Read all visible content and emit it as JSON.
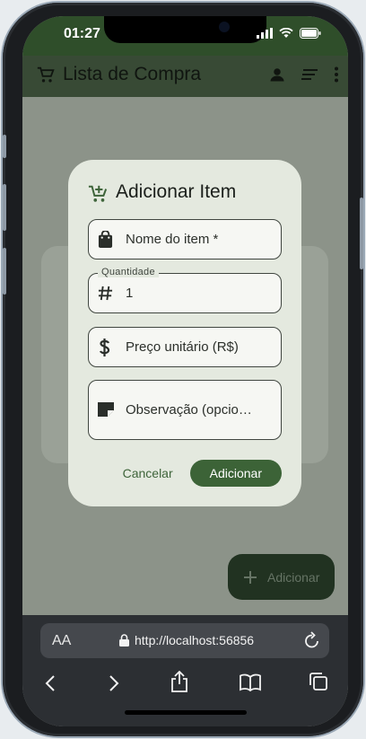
{
  "status": {
    "time": "01:27"
  },
  "appbar": {
    "title": "Lista de Compra"
  },
  "dialog": {
    "title": "Adicionar Item",
    "fields": {
      "name": {
        "placeholder": "Nome do item *"
      },
      "quantity": {
        "label": "Quantidade",
        "value": "1"
      },
      "price": {
        "placeholder": "Preço unitário (R$)"
      },
      "note": {
        "placeholder": "Observação (opcio…"
      }
    },
    "cancel_label": "Cancelar",
    "add_label": "Adicionar"
  },
  "fab": {
    "label": "Adicionar"
  },
  "browser": {
    "aa_label": "AA",
    "url": "http://localhost:56856"
  },
  "colors": {
    "appbar": "#384a35",
    "primary": "#3c6337",
    "dialog_bg": "#e4e9df",
    "fab_bg": "#213221"
  }
}
